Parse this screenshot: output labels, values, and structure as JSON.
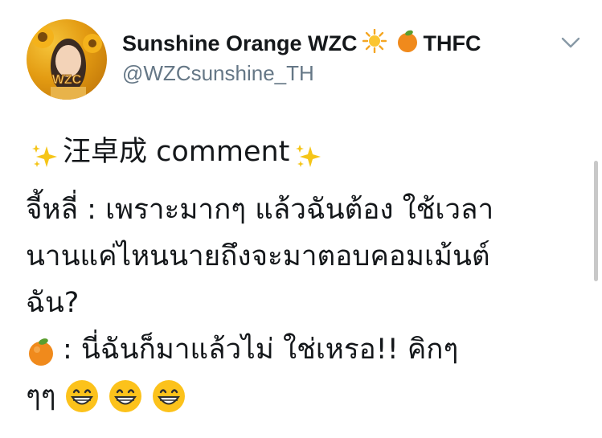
{
  "author": {
    "display_name_prefix": "Sunshine Orange WZC",
    "display_name_suffix": "THFC",
    "handle": "@WZCsunshine_TH",
    "avatar_text": "WZC"
  },
  "tweet": {
    "line1_text": "汪卓成 comment",
    "line2_text": "จี้หลี่ : เพราะมากๆ แล้วฉันต้อง ใช้เวลา",
    "line3_text": "นานแค่ไหนนายถึงจะมาตอบคอมเม้นต์",
    "line4_text": "ฉัน?",
    "line5_text": ": นี่ฉันก็มาแล้วไม่ ใช่เหรอ!! คิกๆ",
    "line6_text": "ๆๆ"
  },
  "icons": {
    "sun": "sun-emoji",
    "orange": "tangerine-emoji",
    "sparkles": "sparkles-emoji",
    "grin": "grinning-face-emoji",
    "menu": "chevron-down-icon"
  },
  "colors": {
    "text": "#14171a",
    "secondary": "#657786",
    "sparkle": "#f5c518",
    "orange": "#f08a1c"
  }
}
